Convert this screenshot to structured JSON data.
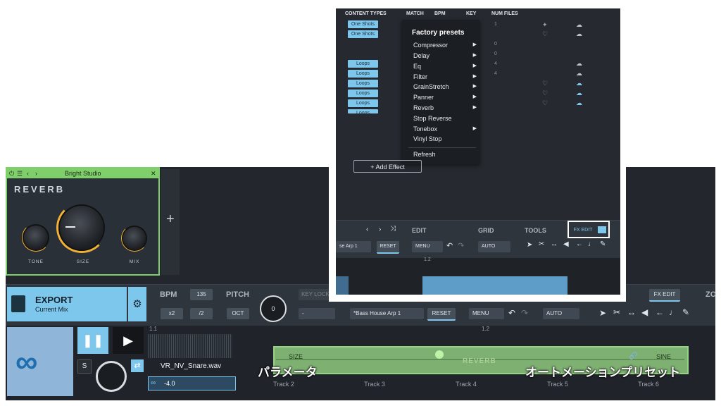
{
  "plugin": {
    "window_title": "Bright Studio",
    "name": "REVERB",
    "knobs": [
      {
        "label": "TONE",
        "level": 0.3
      },
      {
        "label": "SIZE",
        "level": 0.2
      },
      {
        "label": "MIX",
        "level": 0.45
      }
    ],
    "add_label": "+"
  },
  "export": {
    "title": "EXPORT",
    "subtitle": "Current Mix"
  },
  "transport": {
    "bpm_label": "BPM",
    "bpm_value": "135",
    "x2": "x2",
    "div2": "/2",
    "pitch_label": "PITCH",
    "oct": "OCT",
    "pitch_value": "0",
    "key_lock": "KEY LOCK",
    "key_dropdown": "-",
    "preset_dropdown": "*Bass House Arp 1",
    "reset": "RESET",
    "menu": "MENU",
    "auto": "AUTO",
    "fx_edit": "FX EDIT",
    "zoom_partial": "ZO"
  },
  "timeline": {
    "marker1": "1.1",
    "marker2": "1.2"
  },
  "track1": {
    "file": "VR_NV_Snare.wav",
    "value": "-4.0",
    "s": "S"
  },
  "automation": {
    "left": "SIZE",
    "center": "REVERB",
    "right": "SINE"
  },
  "tracks": [
    "Track 2",
    "Track 3",
    "Track 4",
    "Track 5",
    "Track 6"
  ],
  "annotations": {
    "parameter": "パラメータ",
    "automation_preset": "オートメーションプリセット"
  },
  "browser": {
    "headers": [
      "CONTENT TYPES",
      "MATCH",
      "BPM",
      "KEY",
      "NUM FILES"
    ],
    "tags": [
      "One Shots",
      "One Shots",
      "Loops",
      "Loops",
      "Loops",
      "Loops",
      "Loops",
      "Loops"
    ],
    "nums": [
      "1",
      "0",
      "0",
      "4",
      "4"
    ]
  },
  "menu": {
    "title": "Factory presets",
    "items": [
      {
        "label": "Compressor",
        "sub": true
      },
      {
        "label": "Delay",
        "sub": true
      },
      {
        "label": "Eq",
        "sub": true
      },
      {
        "label": "Filter",
        "sub": true
      },
      {
        "label": "GrainStretch",
        "sub": true
      },
      {
        "label": "Panner",
        "sub": true
      },
      {
        "label": "Reverb",
        "sub": true
      },
      {
        "label": "Stop Reverse",
        "sub": false
      },
      {
        "label": "Tonebox",
        "sub": true
      },
      {
        "label": "Vinyl Stop",
        "sub": false
      }
    ],
    "refresh": "Refresh"
  },
  "add_effect": "+ Add Effect",
  "panel_toolbar": {
    "edit": "EDIT",
    "grid": "GRID",
    "tools": "TOOLS",
    "fx_edit": "FX EDIT",
    "preset": "se Arp 1",
    "reset": "RESET",
    "menu": "MENU",
    "auto": "AUTO",
    "marker": "1.2"
  }
}
